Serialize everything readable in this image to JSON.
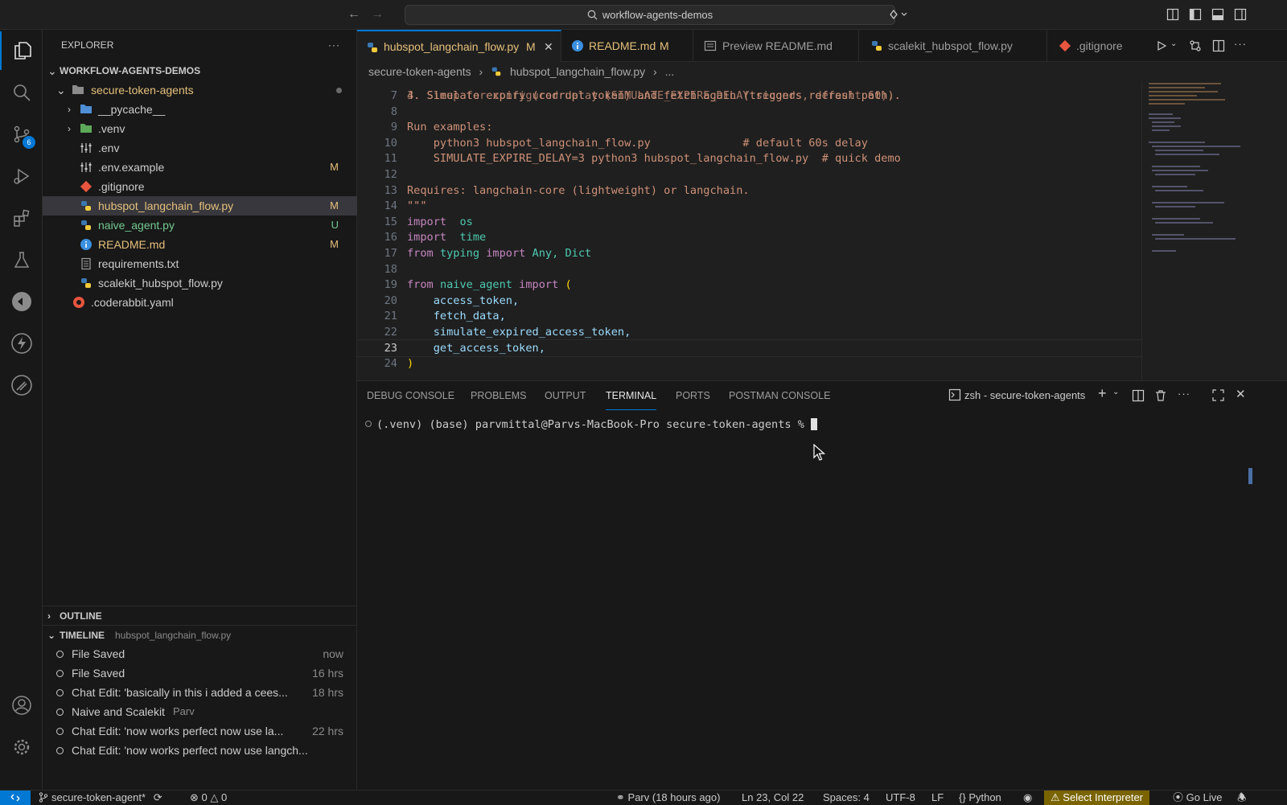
{
  "titlebar": {
    "search_text": "workflow-agents-demos"
  },
  "activity": {
    "scm_badge": "6"
  },
  "explorer": {
    "title": "EXPLORER",
    "more": "···",
    "root": "WORKFLOW-AGENTS-DEMOS",
    "folder": "secure-token-agents",
    "items": [
      {
        "label": "__pycache__",
        "status": ""
      },
      {
        "label": ".venv",
        "status": ""
      },
      {
        "label": ".env",
        "status": ""
      },
      {
        "label": ".env.example",
        "status": "M"
      },
      {
        "label": ".gitignore",
        "status": ""
      },
      {
        "label": "hubspot_langchain_flow.py",
        "status": "M"
      },
      {
        "label": "naive_agent.py",
        "status": "U"
      },
      {
        "label": "README.md",
        "status": "M"
      },
      {
        "label": "requirements.txt",
        "status": ""
      },
      {
        "label": "scalekit_hubspot_flow.py",
        "status": ""
      }
    ],
    "root_file": ".coderabbit.yaml"
  },
  "outline": {
    "title": "OUTLINE"
  },
  "timeline": {
    "title": "TIMELINE",
    "file": "hubspot_langchain_flow.py",
    "entries": [
      {
        "label": "File Saved",
        "time": "now"
      },
      {
        "label": "File Saved",
        "time": "16 hrs"
      },
      {
        "label": "Chat Edit: 'basically in this i added a cees...",
        "time": "18 hrs"
      },
      {
        "label": "Naive and Scalekit",
        "author": "Parv",
        "time": ""
      },
      {
        "label": "Chat Edit: 'now works perfect now use la...",
        "time": "22 hrs"
      },
      {
        "label": "Chat Edit: 'now works perfect now use langch...",
        "time": ""
      }
    ]
  },
  "tabs": [
    {
      "label": "hubspot_langchain_flow.py",
      "mod": "M",
      "close": "✕"
    },
    {
      "label": "README.md",
      "mod": "M"
    },
    {
      "label": "Preview README.md",
      "mod": ""
    },
    {
      "label": "scalekit_hubspot_flow.py",
      "mod": ""
    },
    {
      "label": ".gitignore",
      "mod": ""
    }
  ],
  "breadcrumb": {
    "folder": "secure-token-agents",
    "file": "hubspot_langchain_flow.py",
    "rest": "..."
  },
  "code": {
    "partial_line": "3. Sleep for configured delay (SIMULATE_EXPIRE_DELAY seconds, default 60).",
    "lines": [
      {
        "n": "7",
        "text": "4. Simulate expiry (corrupt token) and fetch again (triggers refresh path)."
      },
      {
        "n": "8",
        "text": ""
      },
      {
        "n": "9",
        "text": "Run examples:"
      },
      {
        "n": "10",
        "text": "    python3 hubspot_langchain_flow.py              # default 60s delay"
      },
      {
        "n": "11",
        "text": "    SIMULATE_EXPIRE_DELAY=3 python3 hubspot_langchain_flow.py  # quick demo"
      },
      {
        "n": "12",
        "text": ""
      },
      {
        "n": "13",
        "text": "Requires: langchain-core (lightweight) or langchain."
      },
      {
        "n": "14",
        "text": "\"\"\""
      },
      {
        "n": "15",
        "kw": "import",
        "rest": " os"
      },
      {
        "n": "16",
        "kw": "import",
        "rest": " time"
      },
      {
        "n": "17",
        "kw": "from",
        "mod": "typing",
        "kw2": "import",
        "rest2": "Any, Dict"
      },
      {
        "n": "18",
        "text": ""
      },
      {
        "n": "19",
        "kw": "from",
        "mod": "naive_agent",
        "kw2": "import",
        "paren": "("
      },
      {
        "n": "20",
        "var": "access_token,"
      },
      {
        "n": "21",
        "var": "fetch_data,"
      },
      {
        "n": "22",
        "var": "simulate_expired_access_token,"
      },
      {
        "n": "23",
        "var": "get_access_token,"
      },
      {
        "n": "24",
        "paren": ")"
      }
    ]
  },
  "panel": {
    "tabs": [
      "DEBUG CONSOLE",
      "PROBLEMS",
      "OUTPUT",
      "TERMINAL",
      "PORTS",
      "POSTMAN CONSOLE"
    ],
    "terminal_name": "zsh - secure-token-agents",
    "prompt": "(.venv) (base) parvmittal@Parvs-MacBook-Pro secure-token-agents % "
  },
  "status": {
    "branch": "secure-token-agent*",
    "errors": "0",
    "warnings": "0",
    "blame": "Parv (18 hours ago)",
    "position": "Ln 23, Col 22",
    "spaces": "Spaces: 4",
    "encoding": "UTF-8",
    "eol": "LF",
    "language": "Python",
    "interpreter": "Select Interpreter",
    "golive": "Go Live"
  }
}
